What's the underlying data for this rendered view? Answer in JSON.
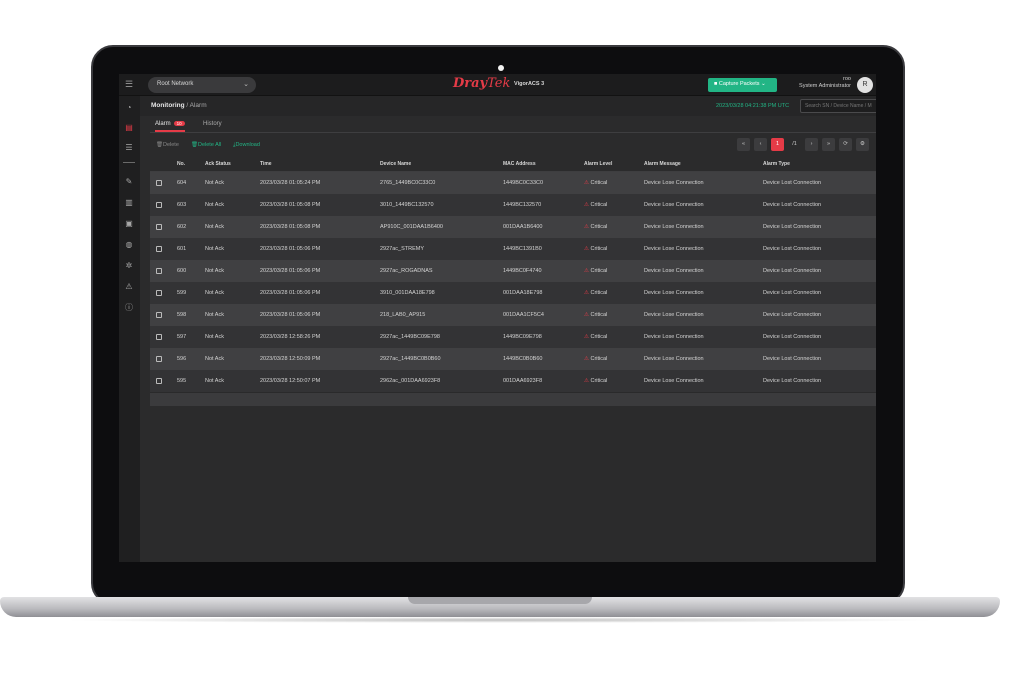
{
  "app": {
    "brand_dray": "Dray",
    "brand_tek": "Tek",
    "product": "VigorACS 3",
    "network_select": "Root Network",
    "capture_button": "Capture Packets",
    "user_line1": "roo",
    "user_line2": "System Administrator",
    "avatar_initial": "R"
  },
  "breadcrumb": {
    "section": "Monitoring",
    "separator": "/",
    "page": "Alarm"
  },
  "datetime": "2023/03/28 04:21:38 PM UTC",
  "search": {
    "placeholder": "Search SN / Device Name / M"
  },
  "tabs": {
    "alarm_label": "Alarm",
    "alarm_count": "10",
    "history_label": "History"
  },
  "toolbar": {
    "delete_label": "Delete",
    "delete_all_label": "Delete All",
    "download_label": "Download"
  },
  "pager": {
    "first": "«",
    "prev": "‹",
    "current": "1",
    "total": "/1",
    "next": "›",
    "last": "»",
    "refresh": "⟳",
    "settings": "⚙"
  },
  "columns": {
    "no": "No.",
    "ack": "Ack Status",
    "time": "Time",
    "device": "Device Name",
    "mac": "MAC Address",
    "level": "Alarm Level",
    "message": "Alarm Message",
    "type": "Alarm Type"
  },
  "rows": [
    {
      "no": "604",
      "ack": "Not Ack",
      "time": "2023/03/28 01:05:24 PM",
      "device": "2765_1449BC0C33C0",
      "mac": "1449BC0C33C0",
      "level": "Critical",
      "message": "Device Lose Connection",
      "type": "Device Lost Connection"
    },
    {
      "no": "603",
      "ack": "Not Ack",
      "time": "2023/03/28 01:05:08 PM",
      "device": "3010_1449BC132570",
      "mac": "1449BC132570",
      "level": "Critical",
      "message": "Device Lose Connection",
      "type": "Device Lost Connection"
    },
    {
      "no": "602",
      "ack": "Not Ack",
      "time": "2023/03/28 01:05:08 PM",
      "device": "AP910C_001DAA1B6400",
      "mac": "001DAA1B6400",
      "level": "Critical",
      "message": "Device Lose Connection",
      "type": "Device Lost Connection"
    },
    {
      "no": "601",
      "ack": "Not Ack",
      "time": "2023/03/28 01:05:06 PM",
      "device": "2927ac_STREMY",
      "mac": "1449BC1391B0",
      "level": "Critical",
      "message": "Device Lose Connection",
      "type": "Device Lost Connection"
    },
    {
      "no": "600",
      "ack": "Not Ack",
      "time": "2023/03/28 01:05:06 PM",
      "device": "2927ac_ROGADNAS",
      "mac": "1449BC0F4740",
      "level": "Critical",
      "message": "Device Lose Connection",
      "type": "Device Lost Connection"
    },
    {
      "no": "599",
      "ack": "Not Ack",
      "time": "2023/03/28 01:05:06 PM",
      "device": "3910_001DAA18E798",
      "mac": "001DAA18E798",
      "level": "Critical",
      "message": "Device Lose Connection",
      "type": "Device Lost Connection"
    },
    {
      "no": "598",
      "ack": "Not Ack",
      "time": "2023/03/28 01:05:06 PM",
      "device": "218_LAB0_AP915",
      "mac": "001DAA1CF5C4",
      "level": "Critical",
      "message": "Device Lose Connection",
      "type": "Device Lost Connection"
    },
    {
      "no": "597",
      "ack": "Not Ack",
      "time": "2023/03/28 12:58:26 PM",
      "device": "2927ac_1449BC09E798",
      "mac": "1449BC09E798",
      "level": "Critical",
      "message": "Device Lose Connection",
      "type": "Device Lost Connection"
    },
    {
      "no": "596",
      "ack": "Not Ack",
      "time": "2023/03/28 12:50:09 PM",
      "device": "2927ac_1449BC0B0B60",
      "mac": "1449BC0B0B60",
      "level": "Critical",
      "message": "Device Lose Connection",
      "type": "Device Lost Connection"
    },
    {
      "no": "595",
      "ack": "Not Ack",
      "time": "2023/03/28 12:50:07 PM",
      "device": "2962ac_001DAA6923F8",
      "mac": "001DAA6923F8",
      "level": "Critical",
      "message": "Device Lose Connection",
      "type": "Device Lost Connection"
    }
  ],
  "colors": {
    "brand_red": "#e53b47",
    "accent_green": "#22b585"
  }
}
